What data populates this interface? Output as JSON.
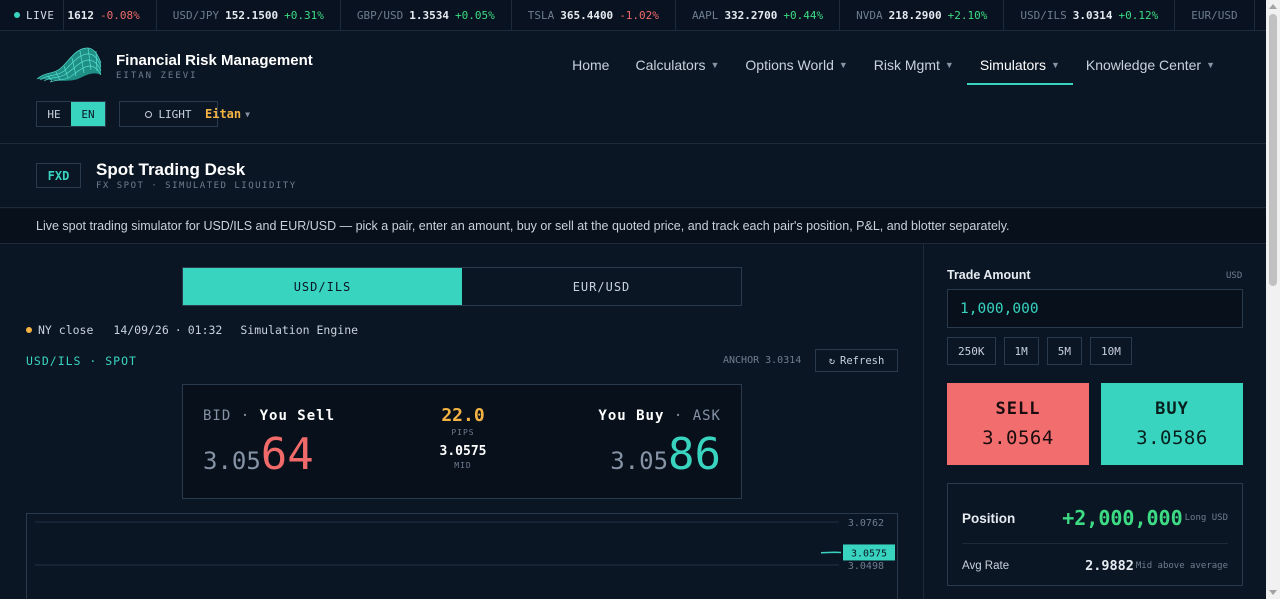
{
  "ticker": {
    "live_label": "LIVE",
    "items": [
      {
        "symbol": "",
        "price": "1612",
        "change": "-0.08%",
        "dir": "down"
      },
      {
        "symbol": "USD/JPY",
        "price": "152.1500",
        "change": "+0.31%",
        "dir": "up"
      },
      {
        "symbol": "GBP/USD",
        "price": "1.3534",
        "change": "+0.05%",
        "dir": "up"
      },
      {
        "symbol": "TSLA",
        "price": "365.4400",
        "change": "-1.02%",
        "dir": "down"
      },
      {
        "symbol": "AAPL",
        "price": "332.2700",
        "change": "+0.44%",
        "dir": "up"
      },
      {
        "symbol": "NVDA",
        "price": "218.2900",
        "change": "+2.10%",
        "dir": "up"
      },
      {
        "symbol": "USD/ILS",
        "price": "3.0314",
        "change": "+0.12%",
        "dir": "up"
      },
      {
        "symbol": "EUR/USD",
        "price": "",
        "change": "",
        "dir": ""
      }
    ]
  },
  "brand": {
    "title": "Financial Risk Management",
    "subtitle": "EITAN ZEEVI"
  },
  "nav": {
    "items": [
      {
        "label": "Home",
        "caret": false,
        "active": false
      },
      {
        "label": "Calculators",
        "caret": true,
        "active": false
      },
      {
        "label": "Options World",
        "caret": true,
        "active": false
      },
      {
        "label": "Risk Mgmt",
        "caret": true,
        "active": false
      },
      {
        "label": "Simulators",
        "caret": true,
        "active": true
      },
      {
        "label": "Knowledge Center",
        "caret": true,
        "active": false
      }
    ]
  },
  "lang": {
    "he": "HE",
    "en": "EN",
    "selected": "EN"
  },
  "theme": {
    "label": "LIGHT"
  },
  "user": {
    "name": "Eitan"
  },
  "page": {
    "badge": "FXD",
    "title": "Spot Trading Desk",
    "subtitle": "FX SPOT · SIMULATED LIQUIDITY"
  },
  "description": "Live spot trading simulator for USD/ILS and EUR/USD — pick a pair, enter an amount, buy or sell at the quoted price, and track each pair's position, P&L, and blotter separately.",
  "pairs": {
    "tabs": [
      "USD/ILS",
      "EUR/USD"
    ],
    "selected": "USD/ILS"
  },
  "status": {
    "session": "NY close",
    "date": "14/09/26",
    "time": "01:32",
    "engine": "Simulation Engine"
  },
  "spot": {
    "label": "USD/ILS · SPOT",
    "anchor": "ANCHOR 3.0314",
    "refresh_label": "Refresh"
  },
  "quote": {
    "bid_word": "BID ·",
    "bid_action": "You Sell",
    "ask_action": "You Buy",
    "ask_word": "· ASK",
    "bid_base": "3.05",
    "bid_pips": "64",
    "ask_base": "3.05",
    "ask_pips": "86",
    "spread": "22.0",
    "spread_unit": "PIPS",
    "mid": "3.0575",
    "mid_unit": "MID"
  },
  "chart_data": {
    "type": "line",
    "y_ticks": [
      "3.0762",
      "3.0498"
    ],
    "current_label": "3.0575",
    "ylim": [
      3.0498,
      3.0762
    ],
    "series": [
      {
        "values": [
          3.0573,
          3.0575,
          3.0576,
          3.0575
        ]
      }
    ]
  },
  "trade": {
    "amount_label": "Trade Amount",
    "amount_ccy": "USD",
    "amount_value": "1,000,000",
    "presets": [
      "250K",
      "1M",
      "5M",
      "10M"
    ],
    "sell_label": "SELL",
    "sell_price": "3.0564",
    "buy_label": "BUY",
    "buy_price": "3.0586"
  },
  "position": {
    "label": "Position",
    "value": "+2,000,000",
    "note": "Long USD",
    "avg_label": "Avg Rate",
    "avg_value": "2.9882",
    "avg_note": "Mid above average"
  },
  "colors": {
    "accent": "#38d4c0",
    "sell": "#f26d6d",
    "up": "#3ddc84",
    "down": "#f06a6a",
    "warn": "#f5b343",
    "bg": "#0b1624"
  }
}
